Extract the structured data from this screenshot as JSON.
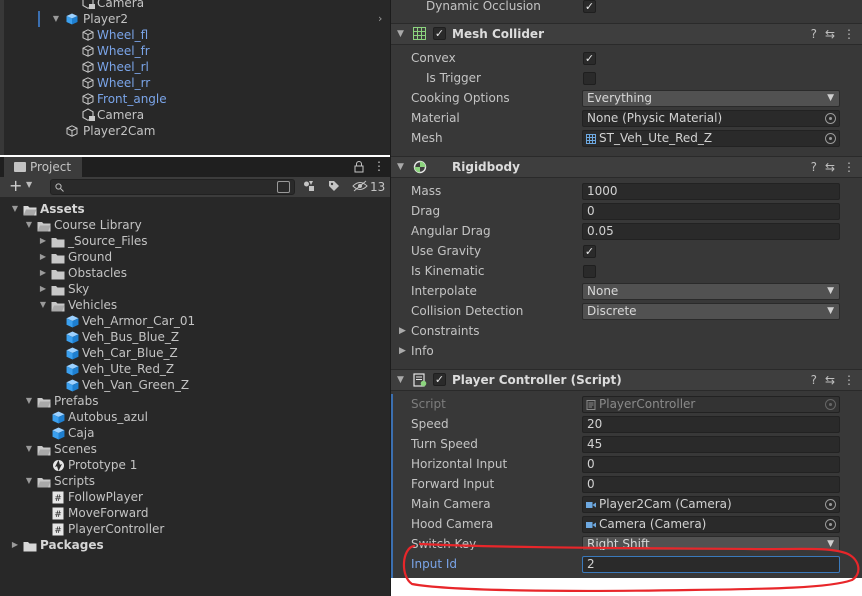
{
  "hierarchy": {
    "items": [
      {
        "label": "Camera",
        "color": "normal"
      },
      {
        "label": "Player2",
        "color": "blue"
      },
      {
        "label": "Wheel_fl",
        "color": "blue"
      },
      {
        "label": "Wheel_fr",
        "color": "blue"
      },
      {
        "label": "Wheel_rl",
        "color": "blue"
      },
      {
        "label": "Wheel_rr",
        "color": "blue"
      },
      {
        "label": "Front_angle",
        "color": "blue"
      },
      {
        "label": "Camera",
        "color": "normal"
      },
      {
        "label": "Player2Cam",
        "color": "normal"
      }
    ]
  },
  "project": {
    "tab_label": "Project",
    "search_placeholder": "",
    "hidden_count": "13",
    "tree": [
      {
        "label": "Assets",
        "type": "folder"
      },
      {
        "label": "Course Library",
        "type": "folder"
      },
      {
        "label": "_Source_Files",
        "type": "folder"
      },
      {
        "label": "Ground",
        "type": "folder"
      },
      {
        "label": "Obstacles",
        "type": "folder"
      },
      {
        "label": "Sky",
        "type": "folder"
      },
      {
        "label": "Vehicles",
        "type": "folder"
      },
      {
        "label": "Veh_Armor_Car_01",
        "type": "prefab"
      },
      {
        "label": "Veh_Bus_Blue_Z",
        "type": "prefab"
      },
      {
        "label": "Veh_Car_Blue_Z",
        "type": "prefab"
      },
      {
        "label": "Veh_Ute_Red_Z",
        "type": "prefab"
      },
      {
        "label": "Veh_Van_Green_Z",
        "type": "prefab"
      },
      {
        "label": "Prefabs",
        "type": "folder"
      },
      {
        "label": "Autobus_azul",
        "type": "prefab"
      },
      {
        "label": "Caja",
        "type": "prefab"
      },
      {
        "label": "Scenes",
        "type": "folder"
      },
      {
        "label": "Prototype 1",
        "type": "scene"
      },
      {
        "label": "Scripts",
        "type": "folder"
      },
      {
        "label": "FollowPlayer",
        "type": "script"
      },
      {
        "label": "MoveForward",
        "type": "script"
      },
      {
        "label": "PlayerController",
        "type": "script"
      },
      {
        "label": "Packages",
        "type": "folder"
      }
    ]
  },
  "inspector": {
    "dynamic_occlusion": {
      "label": "Dynamic Occlusion",
      "checked": "✓"
    },
    "mesh_collider": {
      "title": "Mesh Collider",
      "enabled": "✓",
      "convex": {
        "label": "Convex",
        "checked": "✓"
      },
      "is_trigger": {
        "label": "Is Trigger",
        "checked": ""
      },
      "cooking_options": {
        "label": "Cooking Options",
        "value": "Everything"
      },
      "material": {
        "label": "Material",
        "value": "None (Physic Material)"
      },
      "mesh": {
        "label": "Mesh",
        "value": "ST_Veh_Ute_Red_Z"
      }
    },
    "rigidbody": {
      "title": "Rigidbody",
      "mass": {
        "label": "Mass",
        "value": "1000"
      },
      "drag": {
        "label": "Drag",
        "value": "0"
      },
      "angular_drag": {
        "label": "Angular Drag",
        "value": "0.05"
      },
      "use_gravity": {
        "label": "Use Gravity",
        "checked": "✓"
      },
      "is_kinematic": {
        "label": "Is Kinematic",
        "checked": ""
      },
      "interpolate": {
        "label": "Interpolate",
        "value": "None"
      },
      "collision_detection": {
        "label": "Collision Detection",
        "value": "Discrete"
      },
      "constraints": {
        "label": "Constraints"
      },
      "info": {
        "label": "Info"
      }
    },
    "player_controller": {
      "title": "Player Controller (Script)",
      "enabled": "✓",
      "script": {
        "label": "Script",
        "value": "PlayerController"
      },
      "speed": {
        "label": "Speed",
        "value": "20"
      },
      "turn_speed": {
        "label": "Turn Speed",
        "value": "45"
      },
      "horizontal_input": {
        "label": "Horizontal Input",
        "value": "0"
      },
      "forward_input": {
        "label": "Forward Input",
        "value": "0"
      },
      "main_camera": {
        "label": "Main Camera",
        "value": "Player2Cam (Camera)"
      },
      "hood_camera": {
        "label": "Hood Camera",
        "value": "Camera (Camera)"
      },
      "switch_key": {
        "label": "Switch Key",
        "value": "Right Shift"
      },
      "input_id": {
        "label": "Input Id",
        "value": "2"
      }
    }
  },
  "colors": {
    "accent": "#7aa4e8",
    "annotation": "#e8262a",
    "panel": "#383838",
    "field": "#2a2a2a"
  }
}
